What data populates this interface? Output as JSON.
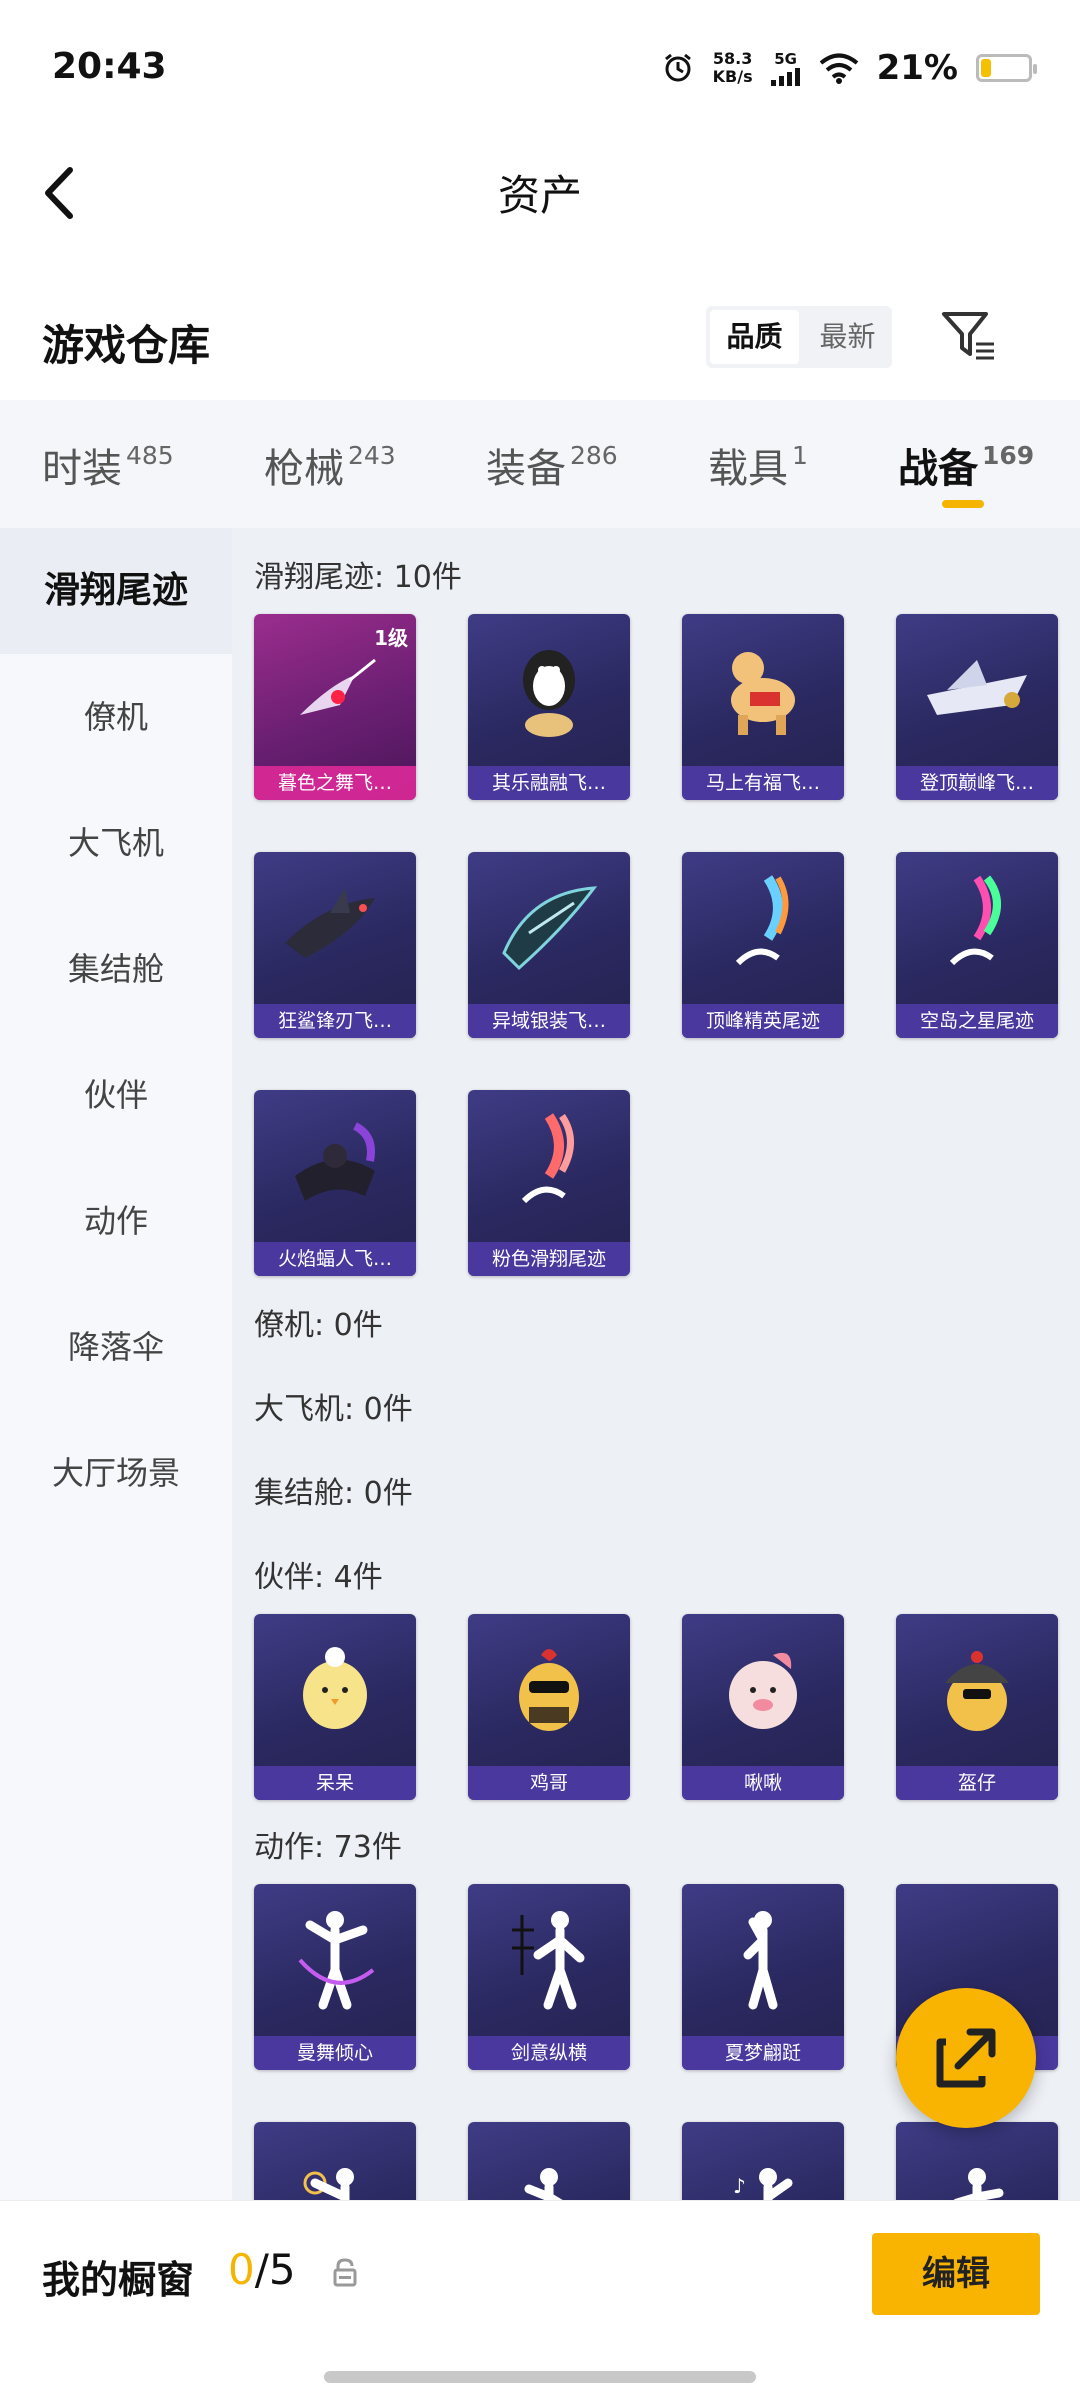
{
  "status": {
    "time": "20:43",
    "speed_value": "58.3",
    "speed_unit": "KB/s",
    "network": "5G",
    "battery_pct": "21%",
    "battery_level": 0.21
  },
  "nav": {
    "title": "资产"
  },
  "header": {
    "title": "游戏仓库",
    "sort_options": [
      "品质",
      "最新"
    ],
    "active_sort": "品质"
  },
  "tabs": [
    {
      "label": "时装",
      "count": "485"
    },
    {
      "label": "枪械",
      "count": "243"
    },
    {
      "label": "装备",
      "count": "286"
    },
    {
      "label": "载具",
      "count": "1"
    },
    {
      "label": "战备",
      "count": "169",
      "active": true
    }
  ],
  "sidebar": {
    "items": [
      "滑翔尾迹",
      "僚机",
      "大飞机",
      "集结舱",
      "伙伴",
      "动作",
      "降落伞",
      "大厅场景"
    ],
    "active": "滑翔尾迹"
  },
  "groups": {
    "trail": {
      "title": "滑翔尾迹: 10件",
      "items": [
        {
          "name": "暮色之舞飞…",
          "level": "1级",
          "rare": true
        },
        {
          "name": "其乐融融飞…"
        },
        {
          "name": "马上有福飞…"
        },
        {
          "name": "登顶巅峰飞…"
        },
        {
          "name": "狂鲨锋刃飞…"
        },
        {
          "name": "异域银装飞…"
        },
        {
          "name": "顶峰精英尾迹"
        },
        {
          "name": "空岛之星尾迹"
        },
        {
          "name": "火焰蝠人飞…"
        },
        {
          "name": "粉色滑翔尾迹"
        }
      ]
    },
    "wingman": {
      "title": "僚机: 0件"
    },
    "plane": {
      "title": "大飞机: 0件"
    },
    "cabin": {
      "title": "集结舱: 0件"
    },
    "partner": {
      "title": "伙伴: 4件",
      "items": [
        {
          "name": "呆呆"
        },
        {
          "name": "鸡哥"
        },
        {
          "name": "啾啾"
        },
        {
          "name": "盔仔"
        }
      ]
    },
    "emote": {
      "title": "动作: 73件",
      "items": [
        {
          "name": "曼舞倾心"
        },
        {
          "name": "剑意纵横"
        },
        {
          "name": "夏梦翩跹"
        },
        {
          "name": ""
        }
      ]
    }
  },
  "bottom": {
    "showcase_label": "我的橱窗",
    "showcase_current": "0",
    "showcase_total": "/5",
    "edit_label": "编辑"
  },
  "colors": {
    "accent": "#f8b400",
    "card": "#2f2c6c",
    "rare": "#b02a96"
  },
  "icons": [
    "back-arrow-icon",
    "filter-icon",
    "alarm-icon",
    "signal-icon",
    "wifi-icon",
    "battery-icon",
    "share-icon",
    "lock-icon"
  ]
}
